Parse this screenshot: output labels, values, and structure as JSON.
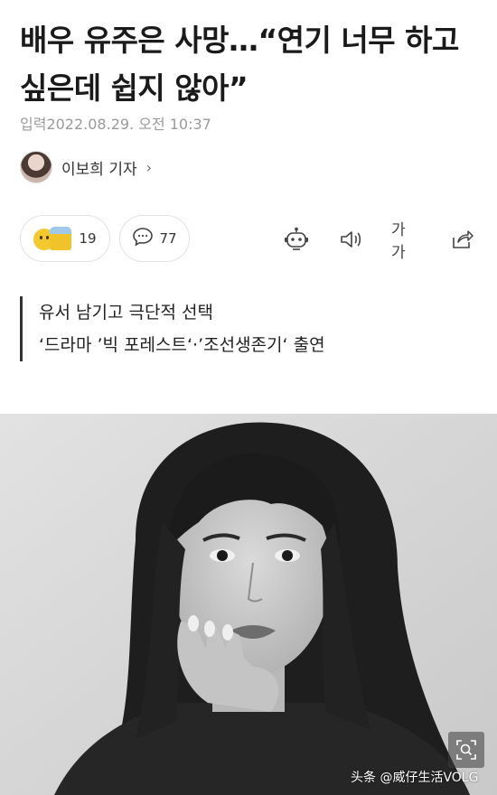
{
  "article": {
    "headline": "배우 유주은 사망…“연기 너무 하고 싶은데 쉽지 않아”",
    "dateline": "입력2022.08.29. 오전 10:37",
    "author": {
      "name": "이보희 기자",
      "chevron": "›"
    },
    "reactions": {
      "count": "19",
      "icons": [
        "smile-emoji-icon",
        "cheer-emoji-icon"
      ]
    },
    "comments": {
      "count": "77",
      "icon": "comment-bubble-icon"
    },
    "tools": {
      "robot": "robot-icon",
      "speaker": "speaker-icon",
      "fontsize_label": "가가",
      "share": "share-icon"
    },
    "summary": [
      "유서 남기고 극단적 선택",
      "‘드라마 ’빅 포레스트‘·’조선생존기‘ 출연"
    ]
  },
  "photo": {
    "description_icon": "portrait-photo",
    "zoom_icon": "zoom-scan-icon"
  },
  "watermark": "头条 @威仔生活VOLG"
}
